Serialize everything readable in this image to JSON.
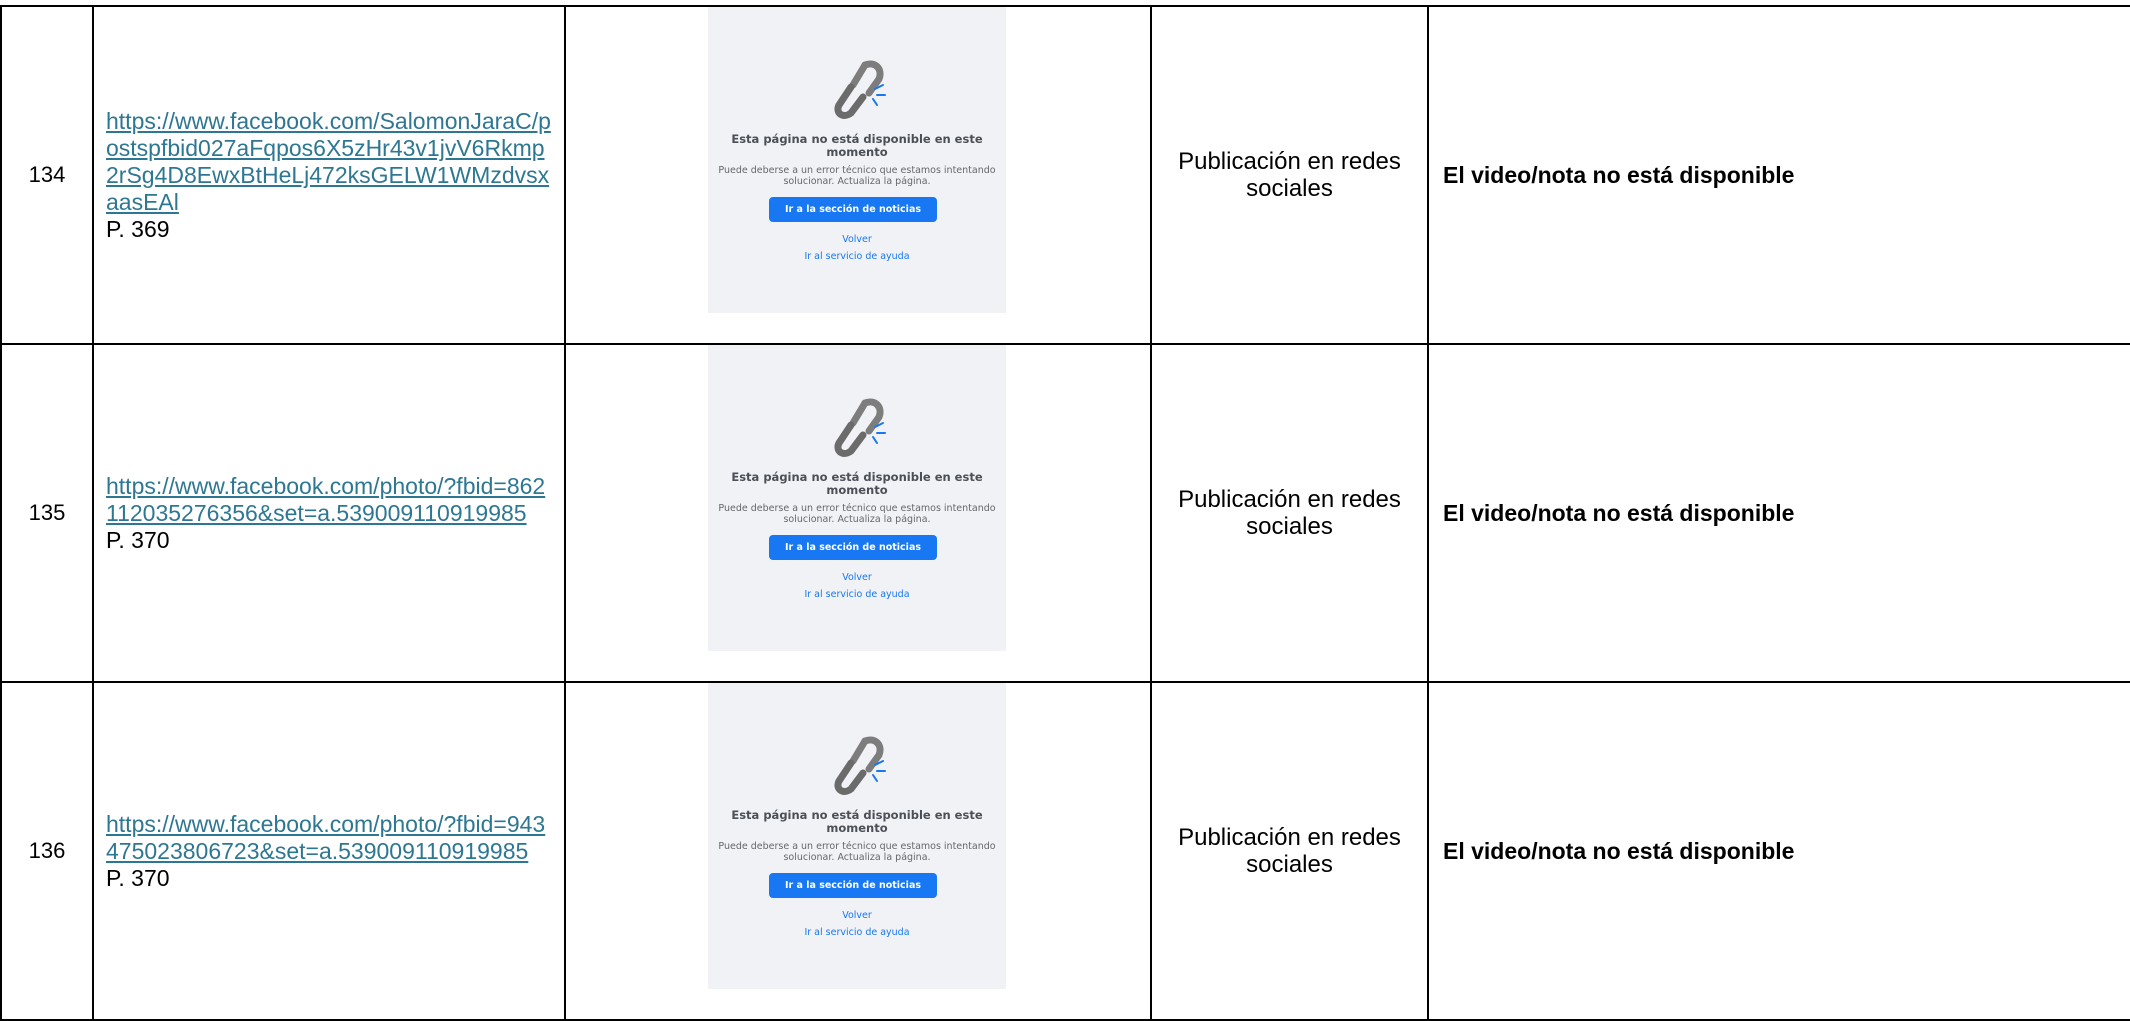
{
  "rows": [
    {
      "number": "134",
      "url": "https://www.facebook.com/SalomonJaraC/postspfbid027aFqpos6X5zHr43v1jvV6Rkmp2rSg4D8EwxBtHeLj472ksGELW1WMzdvsxaasEAl",
      "page": "P. 369",
      "type": "Publicación en redes sociales",
      "status": "El video/nota no está disponible"
    },
    {
      "number": "135",
      "url": "https://www.facebook.com/photo/?fbid=862112035276356&set=a.539009110919985",
      "page": "P. 370",
      "type": "Publicación en redes sociales",
      "status": "El video/nota no está disponible"
    },
    {
      "number": "136",
      "url": "https://www.facebook.com/photo/?fbid=943475023806723&set=a.539009110919985",
      "page": "P. 370",
      "type": "Publicación en redes sociales",
      "status": "El video/nota no está disponible"
    }
  ],
  "screenshot": {
    "title": "Esta página no está disponible en este momento",
    "description": "Puede deberse a un error técnico que estamos intentando solucionar. Actualiza la página.",
    "primary_button": "Ir a la sección de noticias",
    "back_link": "Volver",
    "help_link": "Ir al servicio de ayuda",
    "icon": "broken-link-icon",
    "colors": {
      "background": "#f0f2f5",
      "button": "#1877f2",
      "link": "#1877f2"
    }
  },
  "colors": {
    "url_link": "#2e7792",
    "border": "#000000"
  }
}
